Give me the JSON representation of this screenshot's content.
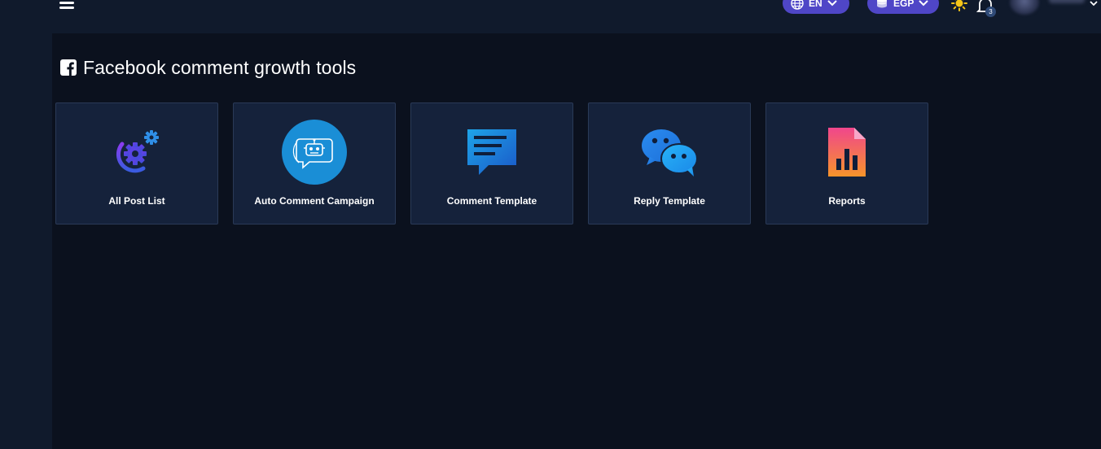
{
  "header": {
    "language": {
      "label": "EN",
      "icon": "globe-icon"
    },
    "currency": {
      "label": "EGP",
      "icon": "coins-icon"
    },
    "theme_icon": "sun-icon",
    "notifications": {
      "icon": "bell-icon",
      "count": "3"
    },
    "menu_icon": "hamburger-icon"
  },
  "page": {
    "title": "Facebook comment growth tools",
    "title_icon": "facebook-icon"
  },
  "tools": [
    {
      "label": "All Post List",
      "icon": "gears-icon"
    },
    {
      "label": "Auto Comment Campaign",
      "icon": "robot-chat-icon"
    },
    {
      "label": "Comment Template",
      "icon": "comment-template-icon"
    },
    {
      "label": "Reply Template",
      "icon": "reply-chat-bubbles-icon"
    },
    {
      "label": "Reports",
      "icon": "report-document-icon"
    }
  ],
  "colors": {
    "background": "#0b111e",
    "panel": "#101a2c",
    "card": "#15223b",
    "card_border": "#2a3a57",
    "pill": "#4f46c7",
    "text": "#ffffff"
  }
}
